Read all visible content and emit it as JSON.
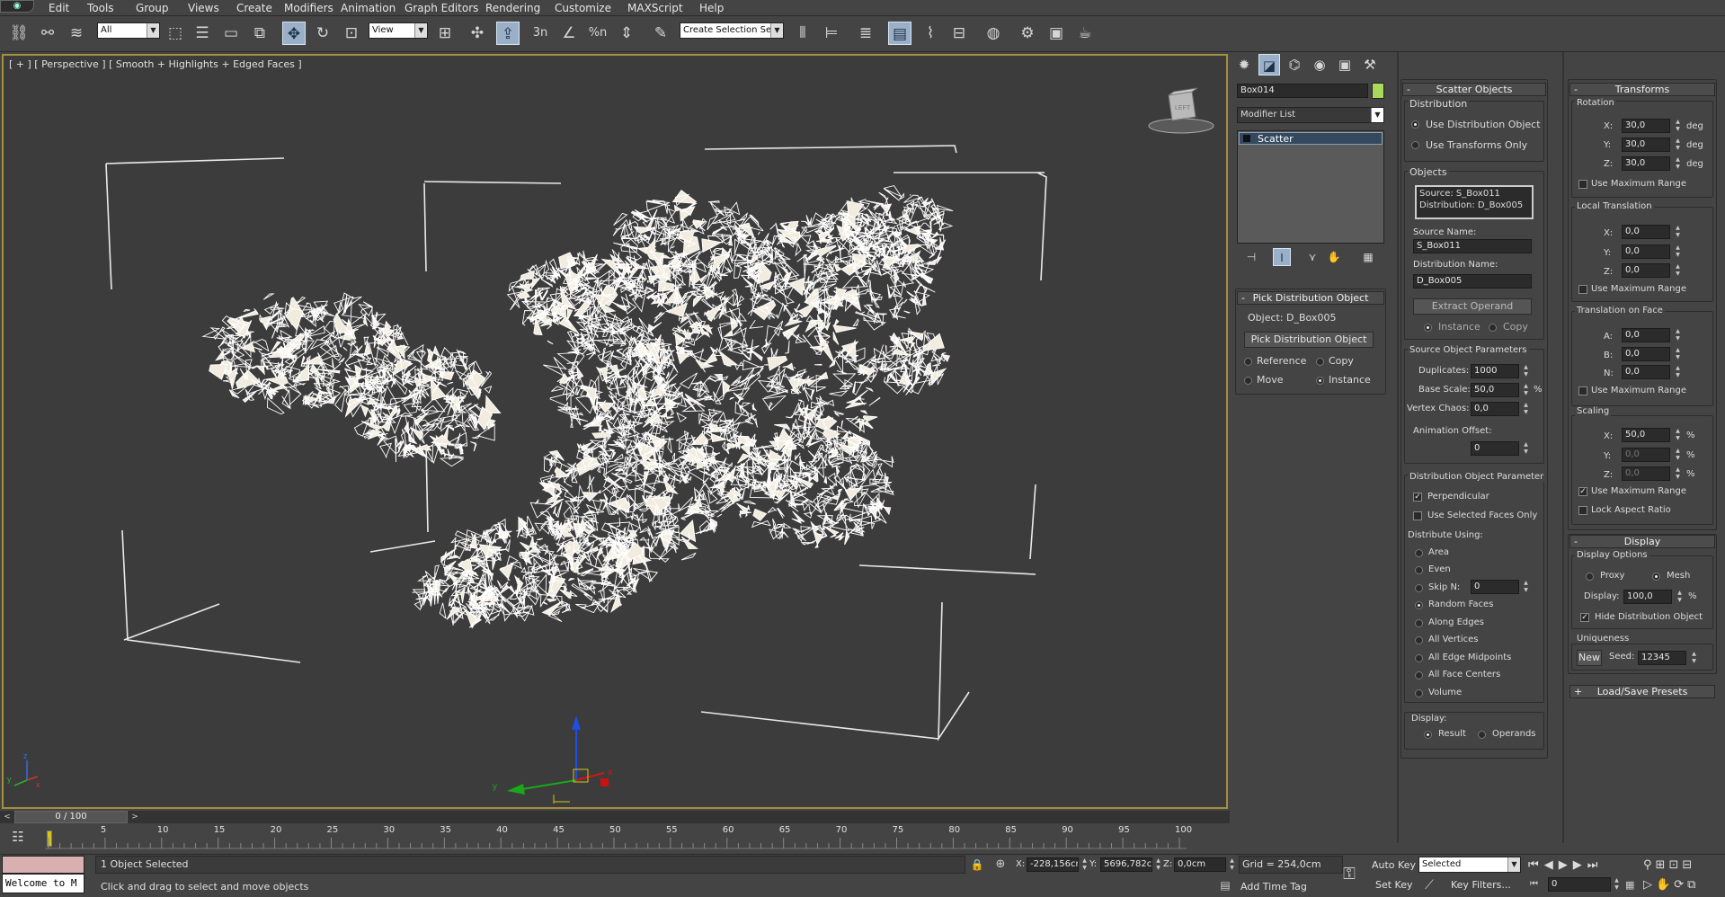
{
  "menubar": {
    "items": [
      "Edit",
      "Tools",
      "Group",
      "Views",
      "Create",
      "Modifiers",
      "Animation",
      "Graph Editors",
      "Rendering",
      "Customize",
      "MAXScript",
      "Help"
    ]
  },
  "toolbar": {
    "filter_value": "All",
    "refcoord_value": "View",
    "snap_labels": [
      "3n",
      "%n"
    ],
    "selection_set_value": "Create Selection Se",
    "accent_color": "#9ab0c8"
  },
  "viewport": {
    "label": "[ + ] [ Perspective ] [ Smooth + Highlights + Edged Faces ]",
    "viewcube_label": "LEFT",
    "gizmo_labels": {
      "x": "x",
      "y": "y",
      "z": "z"
    },
    "border_color": "#a48f3d",
    "object_color": "#f2ecdf"
  },
  "command_panel": {
    "object_name": "Box014",
    "object_color": "#a8d85c",
    "modifier_list": "Modifier List",
    "stack_item": "Scatter"
  },
  "pick_rollout": {
    "title": "Pick Distribution Object",
    "object_text": "Object: D_Box005",
    "pick_button": "Pick Distribution Object",
    "options": [
      "Reference",
      "Copy",
      "Move",
      "Instance"
    ]
  },
  "scatter": {
    "title": "Scatter Objects",
    "distribution_group": "Distribution",
    "use_distribution": "Use Distribution Object",
    "use_transforms": "Use Transforms Only",
    "objects_group": "Objects",
    "source_list_1": "Source: S_Box011",
    "source_list_2": "Distribution: D_Box005",
    "source_name_label": "Source Name:",
    "source_name": "S_Box011",
    "distribution_name_label": "Distribution Name:",
    "distribution_name": "D_Box005",
    "extract_button": "Extract Operand",
    "instance": "Instance",
    "copy": "Copy",
    "source_params": "Source Object Parameters",
    "duplicates_label": "Duplicates:",
    "duplicates": "1000",
    "base_scale_label": "Base Scale:",
    "base_scale": "50,0",
    "pct": "%",
    "vertex_chaos_label": "Vertex Chaos:",
    "vertex_chaos": "0,0",
    "anim_offset_label": "Animation Offset:",
    "anim_offset": "0",
    "dist_params": "Distribution Object Parameter",
    "perpendicular": "Perpendicular",
    "use_selected": "Use Selected Faces Only",
    "distribute_using": "Distribute Using:",
    "dist_options": [
      "Area",
      "Even",
      "Skip N:",
      "Random Faces",
      "Along Edges",
      "All Vertices",
      "All Edge Midpoints",
      "All Face Centers",
      "Volume"
    ],
    "skip_n": "0",
    "display_label": "Display:",
    "result": "Result",
    "operands": "Operands"
  },
  "transforms": {
    "title": "Transforms",
    "rotation": "Rotation",
    "rot": [
      "30,0",
      "30,0",
      "30,0"
    ],
    "deg": "deg",
    "axes": [
      "X:",
      "Y:",
      "Z:"
    ],
    "use_max_range": "Use Maximum Range",
    "local_translation": "Local Translation",
    "lt": [
      "0,0",
      "0,0",
      "0,0"
    ],
    "translation_on_face": "Translation on Face",
    "tof_axes": [
      "A:",
      "B:",
      "N:"
    ],
    "tof": [
      "0,0",
      "0,0",
      "0,0"
    ],
    "scaling": "Scaling",
    "sc": [
      "50,0",
      "0,0",
      "0,0"
    ],
    "pct": "%",
    "lock_aspect": "Lock Aspect Ratio"
  },
  "display": {
    "title": "Display",
    "options": "Display Options",
    "proxy": "Proxy",
    "mesh": "Mesh",
    "display_label": "Display:",
    "display_value": "100,0",
    "pct": "%",
    "hide_dist": "Hide Distribution Object",
    "uniqueness": "Uniqueness",
    "new_button": "New",
    "seed_label": "Seed:",
    "seed": "12345",
    "presets": "Load/Save Presets"
  },
  "timeline": {
    "frame": "0 / 100",
    "ticks": [
      "5",
      "10",
      "15",
      "20",
      "25",
      "30",
      "35",
      "40",
      "45",
      "50",
      "55",
      "60",
      "65",
      "70",
      "75",
      "80",
      "85",
      "90",
      "95",
      "100"
    ]
  },
  "status": {
    "maxscript": "Welcome to M",
    "selected": "1 Object Selected",
    "prompt": "Click and drag to select and move objects",
    "x_label": "X:",
    "x": "-228,156cr",
    "y_label": "Y:",
    "y": "5696,782c",
    "z_label": "Z:",
    "z": "0,0cm",
    "grid": "Grid = 254,0cm",
    "add_time_tag": "Add Time Tag",
    "auto_key": "Auto Key",
    "set_key": "Set Key",
    "selected_value": "Selected",
    "key_filters": "Key Filters...",
    "frame": "0"
  }
}
